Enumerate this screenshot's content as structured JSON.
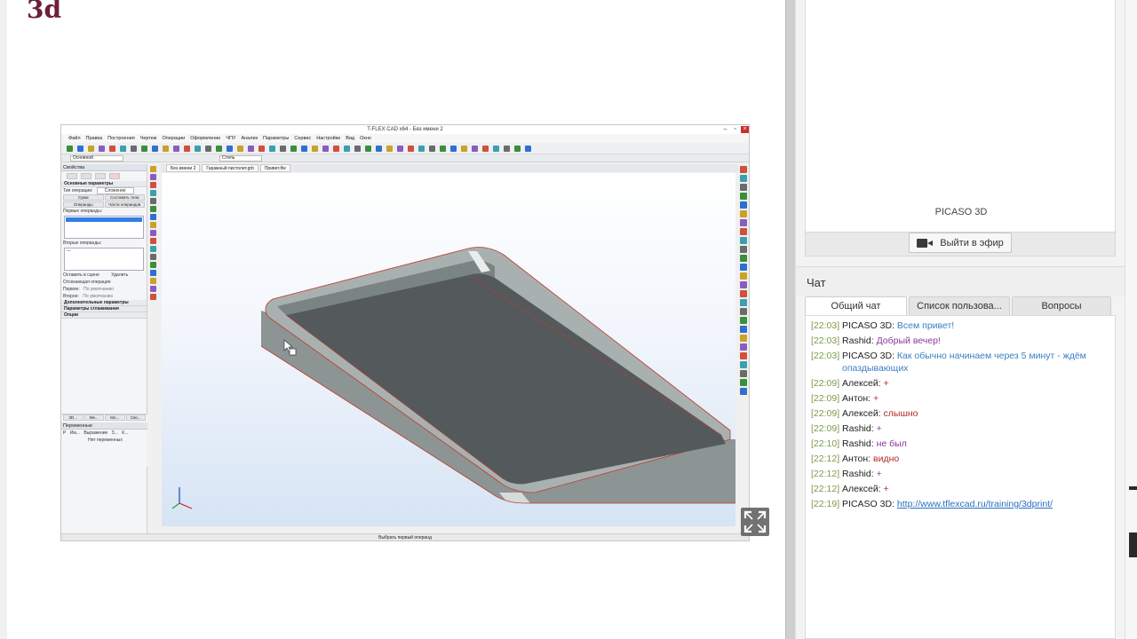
{
  "site": {
    "logo_text": "3d"
  },
  "cad": {
    "window_title": "T-FLEX CAD x64 - Без имени 2",
    "menu": [
      "Файл",
      "Правка",
      "Построения",
      "Чертеж",
      "Операции",
      "Оформление",
      "ЧПУ",
      "Анализ",
      "Параметры",
      "Сервис",
      "Настройки",
      "Вид",
      "Окно"
    ],
    "layer_field": "Основной",
    "style_field": "Стиль",
    "doc_tabs": [
      "Без имени 2",
      "Гаражный пистолет.grb",
      "Привет.tfw"
    ],
    "props_title": "Свойства",
    "section_main": "Основные параметры",
    "op_type_label": "Тип операции:",
    "op_type_value": "Сложение",
    "tab_a": "Сумм",
    "tab_b": "Составить тела",
    "tab_c": "Операнды",
    "tab_d": "Части операндов",
    "first_operands_label": "Первые операнды:",
    "second_operands_label": "Вторые операнды:",
    "second_operands_value": "---",
    "keep_label": "Оставить в сцене",
    "delete_label": "Удалить",
    "trim_label": "Отсекающая операция",
    "first_label": "Первое:",
    "first_value": "По умолчанию",
    "second_label": "Второе:",
    "second_value": "По умолчанию",
    "section_extra": "Дополнительные параметры",
    "section_smooth": "Параметры сглаживания",
    "section_options": "Опции",
    "bottom_tabs": [
      "3D...",
      "Ме...",
      "Мо...",
      "Сво..."
    ],
    "vars_title": "Переменные",
    "vars_cols": [
      "Р",
      "Им...",
      "Выражение",
      "З...",
      "К..."
    ],
    "vars_empty": "Нет переменных",
    "status_text": "Выбрать первый операнд"
  },
  "broadcast": {
    "name": "PICASO 3D",
    "live_label": "Выйти в эфир"
  },
  "chat": {
    "title": "Чат",
    "tabs": [
      "Общий чат",
      "Список пользова...",
      "Вопросы"
    ],
    "messages": [
      {
        "time": "[22:03]",
        "user": "PICASO 3D:",
        "text": "Всем привет!",
        "color": "#3b7fc4"
      },
      {
        "time": "[22:03]",
        "user": "Rashid:",
        "text": "Добрый вечер!",
        "color": "#8a3a9a"
      },
      {
        "time": "[22:03]",
        "user": "PICASO 3D:",
        "text": "Как обычно начинаем через 5 минут - ждём опаздывающих",
        "color": "#3b7fc4"
      },
      {
        "time": "[22:09]",
        "user": "Алексей:",
        "text": "+",
        "color": "#b02a2a"
      },
      {
        "time": "[22:09]",
        "user": "Антон:",
        "text": "+",
        "color": "#b02a2a"
      },
      {
        "time": "[22:09]",
        "user": "Алексей:",
        "text": "слышно",
        "color": "#b02a2a"
      },
      {
        "time": "[22:09]",
        "user": "Rashid:",
        "text": "+",
        "color": "#8a3a9a"
      },
      {
        "time": "[22:10]",
        "user": "Rashid:",
        "text": "не был",
        "color": "#8a3a9a"
      },
      {
        "time": "[22:12]",
        "user": "Антон:",
        "text": "видно",
        "color": "#b02a2a"
      },
      {
        "time": "[22:12]",
        "user": "Rashid:",
        "text": "+",
        "color": "#8a3a9a"
      },
      {
        "time": "[22:12]",
        "user": "Алексей:",
        "text": "+",
        "color": "#b02a2a"
      },
      {
        "time": "[22:19]",
        "user": "PICASO 3D:",
        "text": "http://www.tflexcad.ru/training/3dprint/",
        "color": "#2a6fbf"
      }
    ]
  }
}
